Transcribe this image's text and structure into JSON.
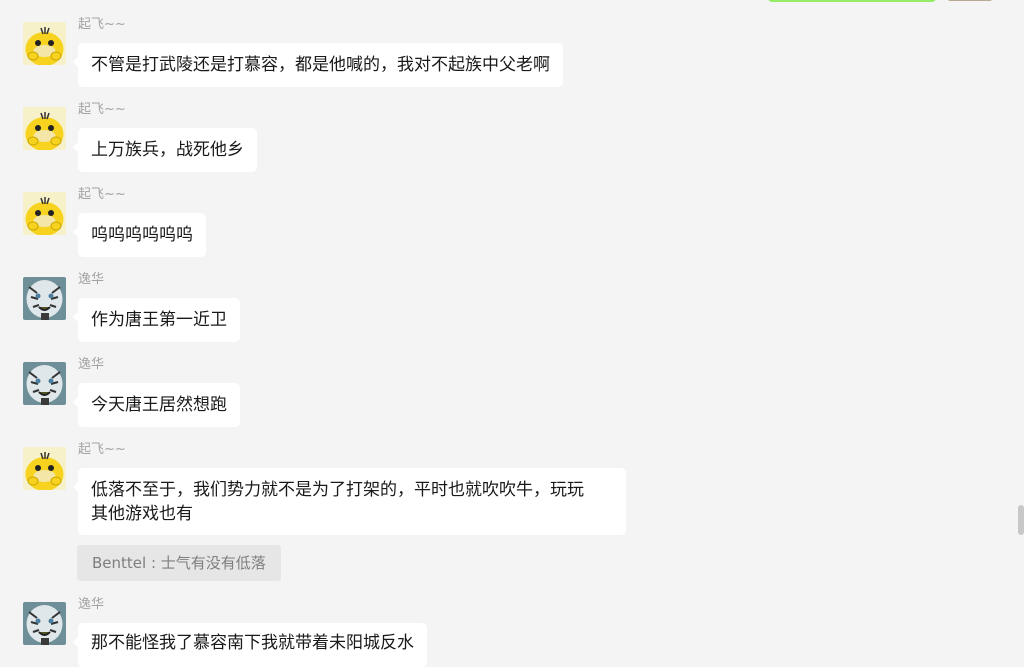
{
  "messages": [
    {
      "sender": "起飞~~",
      "avatar": "yellow-duck-avatar",
      "text": "不管是打武陵还是打慕容，都是他喊的，我对不起族中父老啊"
    },
    {
      "sender": "起飞~~",
      "avatar": "yellow-duck-avatar",
      "text": "上万族兵，战死他乡"
    },
    {
      "sender": "起飞~~",
      "avatar": "yellow-duck-avatar",
      "text": "呜呜呜呜呜呜"
    },
    {
      "sender": "逸华",
      "avatar": "white-tiger-avatar",
      "text": "作为唐王第一近卫"
    },
    {
      "sender": "逸华",
      "avatar": "white-tiger-avatar",
      "text": "今天唐王居然想跑"
    },
    {
      "sender": "起飞~~",
      "avatar": "yellow-duck-avatar",
      "text_lines": [
        "低落不至于，我们势力就不是为了打架的，平时也就吹吹牛，玩玩",
        "其他游戏也有"
      ]
    },
    {
      "sender": "逸华",
      "avatar": "white-tiger-avatar",
      "text": "那不能怪我了慕容南下我就带着未阳城反水"
    }
  ],
  "quote": {
    "text": "Benttel : 士气有没有低落"
  },
  "colors": {
    "background": "#f4f4f4",
    "bubble": "#ffffff",
    "self_bubble": "#95ec69",
    "sender_name": "#a3a3a3",
    "quote_bg": "#e6e6e6"
  }
}
